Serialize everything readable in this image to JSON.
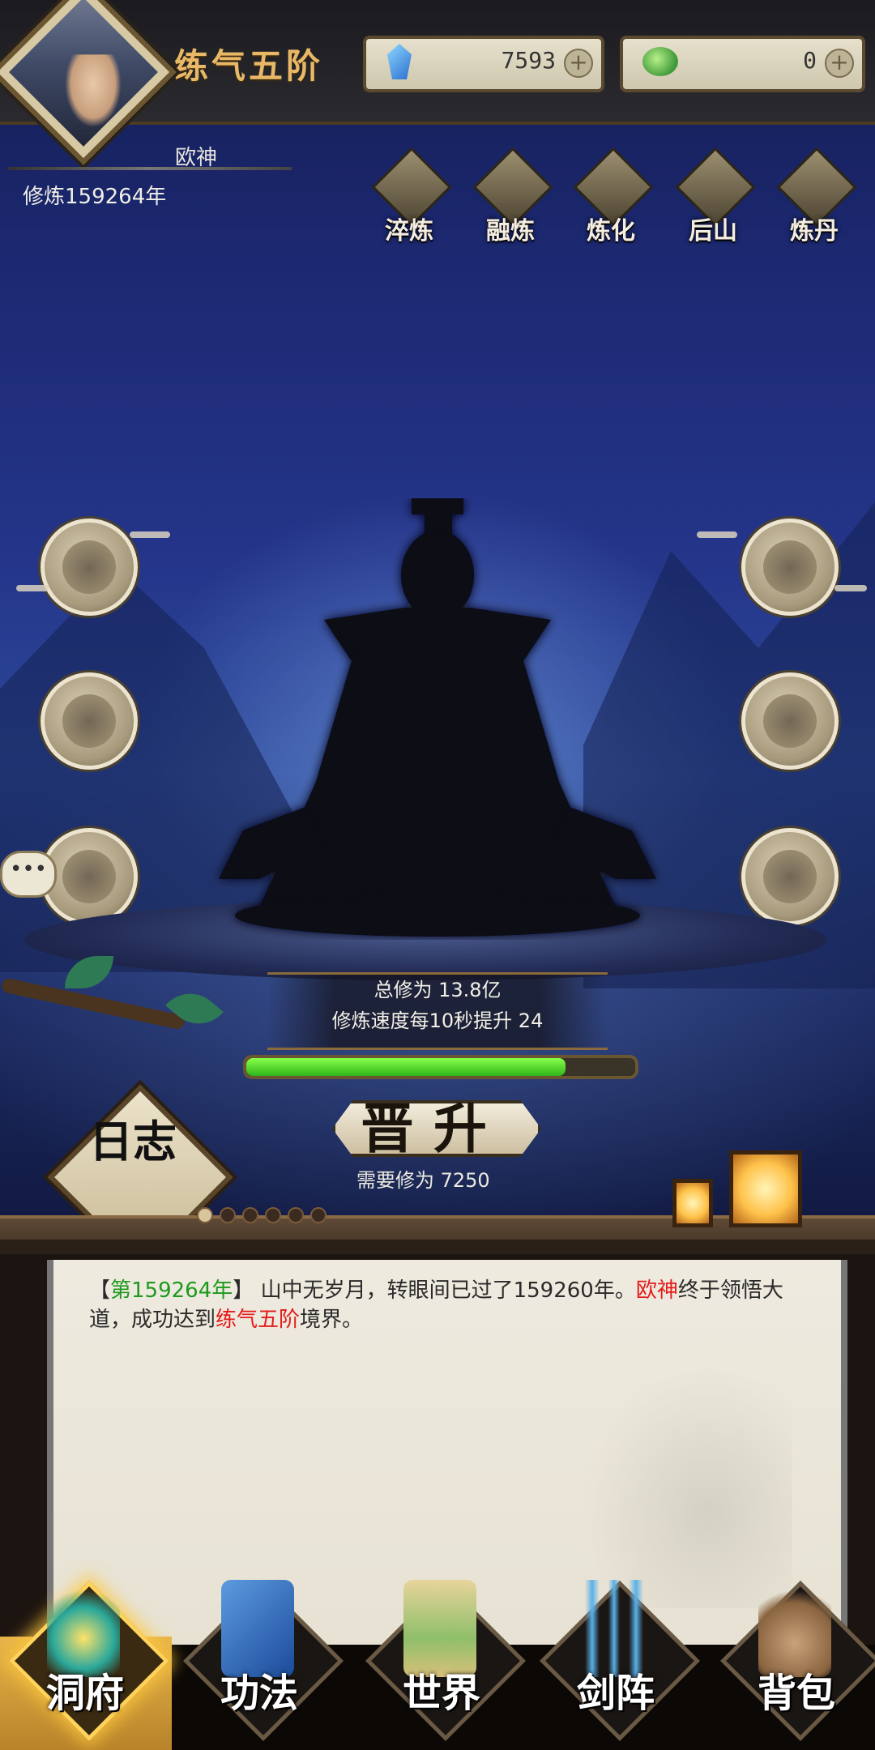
{
  "header": {
    "realm": "练气五阶",
    "player_name": "欧神",
    "cultivation_years": "修炼159264年",
    "spirit_stones": "7593",
    "jade": "0",
    "plus": "+"
  },
  "features": [
    {
      "label": "淬炼",
      "icon": "cauldron-icon"
    },
    {
      "label": "融炼",
      "icon": "sword-furnace-icon"
    },
    {
      "label": "炼化",
      "icon": "refine-icon"
    },
    {
      "label": "后山",
      "icon": "mountain-icon"
    },
    {
      "label": "炼丹",
      "icon": "alchemy-icon"
    }
  ],
  "chat_button": "•••",
  "stats": {
    "total_cultivation": "总修为 13.8亿",
    "speed": "修炼速度每10秒提升 24",
    "progress": 0.82
  },
  "promote": {
    "label": "晋升",
    "requirement": "需要修为 7250"
  },
  "log_button": "日志",
  "log": {
    "bracket_open": "【",
    "year": "第159264年",
    "bracket_close": "】",
    "text1": "山中无岁月，转眼间已过了159260年。",
    "name": "欧神",
    "text2": "终于领悟大道，成功达到",
    "realm": "练气五阶",
    "text3": "境界。"
  },
  "nav": [
    {
      "label": "洞府",
      "active": true
    },
    {
      "label": "功法",
      "active": false
    },
    {
      "label": "世界",
      "active": false
    },
    {
      "label": "剑阵",
      "active": false
    },
    {
      "label": "背包",
      "active": false
    }
  ]
}
